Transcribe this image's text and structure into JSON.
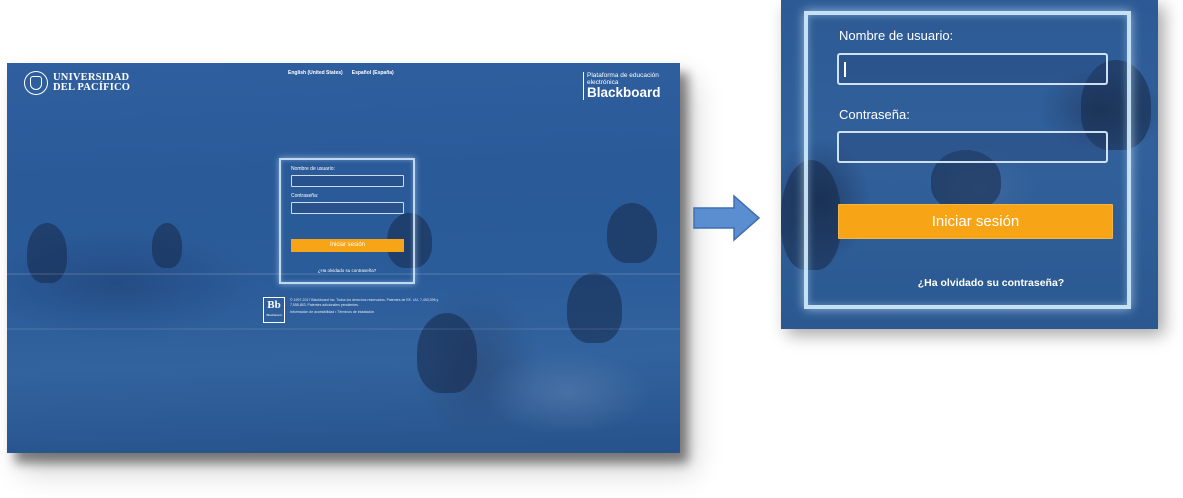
{
  "header": {
    "university_line1": "UNIVERSIDAD",
    "university_line2": "DEL PACÍFICO",
    "languages": [
      "English (United States)",
      "Español (España)"
    ],
    "platform_sub1": "Plataforma de educación",
    "platform_sub2": "electrónica",
    "platform_brand": "Blackboard"
  },
  "login": {
    "username_label": "Nombre de usuario:",
    "password_label": "Contraseña:",
    "submit_label": "Iniciar sesión",
    "forgot_label": "¿Ha olvidado su contraseña?"
  },
  "footer": {
    "bb_mark": "Bb",
    "bb_wordmark": "Blackboard",
    "legal_text": "© 1997-2017 Blackboard Inc. Todos los derechos reservados. Patentes de EE. UU. 7,493,396 y 7,558,853. Patentes adicionales pendientes.",
    "links_text": "Información de accesibilidad • Términos de instalación"
  },
  "colors": {
    "overlay_blue": "#2f5f9e",
    "button_orange": "#f7a416",
    "frame_glow": "#d7f0ff"
  },
  "icons": {
    "arrow": "arrow-right-icon",
    "seal": "university-seal-icon"
  }
}
